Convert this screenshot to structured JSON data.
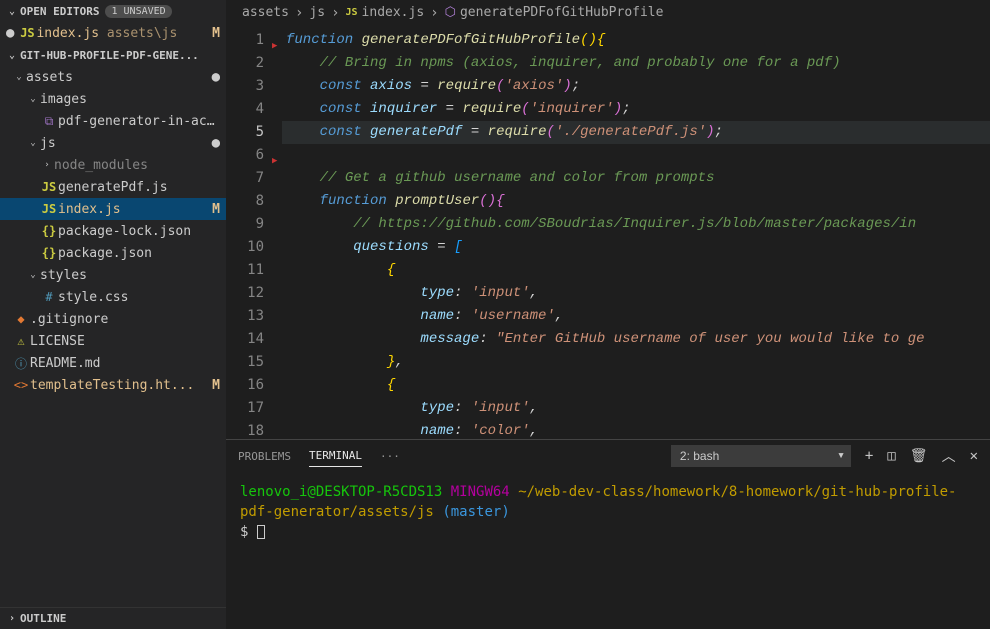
{
  "sidebar": {
    "openEditors": {
      "title": "OPEN EDITORS",
      "badge": "1 UNSAVED",
      "items": [
        {
          "name": "index.js",
          "path": "assets\\js",
          "status": "M",
          "iconClass": "icon-js",
          "iconText": "JS",
          "modified": true
        }
      ]
    },
    "project": {
      "title": "GIT-HUB-PROFILE-PDF-GENE...",
      "tree": [
        {
          "type": "folder",
          "name": "assets",
          "depth": 0,
          "open": true,
          "dot": true
        },
        {
          "type": "folder",
          "name": "images",
          "depth": 1,
          "open": true
        },
        {
          "type": "file",
          "name": "pdf-generator-in-acti...",
          "depth": 2,
          "iconClass": "icon-img",
          "iconText": "⧉"
        },
        {
          "type": "folder",
          "name": "js",
          "depth": 1,
          "open": true,
          "dot": true
        },
        {
          "type": "folder",
          "name": "node_modules",
          "depth": 2,
          "open": false,
          "dim": true
        },
        {
          "type": "file",
          "name": "generatePdf.js",
          "depth": 2,
          "iconClass": "icon-js",
          "iconText": "JS"
        },
        {
          "type": "file",
          "name": "index.js",
          "depth": 2,
          "iconClass": "icon-js",
          "iconText": "JS",
          "status": "M",
          "active": true,
          "modified": true
        },
        {
          "type": "file",
          "name": "package-lock.json",
          "depth": 2,
          "iconClass": "icon-json",
          "iconText": "{}"
        },
        {
          "type": "file",
          "name": "package.json",
          "depth": 2,
          "iconClass": "icon-json",
          "iconText": "{}"
        },
        {
          "type": "folder",
          "name": "styles",
          "depth": 1,
          "open": true
        },
        {
          "type": "file",
          "name": "style.css",
          "depth": 2,
          "iconClass": "icon-css",
          "iconText": "#"
        },
        {
          "type": "file",
          "name": ".gitignore",
          "depth": 0,
          "iconClass": "icon-git",
          "iconText": "◆"
        },
        {
          "type": "file",
          "name": "LICENSE",
          "depth": 0,
          "iconClass": "icon-lic",
          "iconText": "⚠"
        },
        {
          "type": "file",
          "name": "README.md",
          "depth": 0,
          "iconClass": "icon-md",
          "iconText": "ⓘ"
        },
        {
          "type": "file",
          "name": "templateTesting.ht...",
          "depth": 0,
          "iconClass": "icon-html",
          "iconText": "<>",
          "status": "M",
          "modified": true
        }
      ]
    },
    "outline": {
      "title": "OUTLINE"
    }
  },
  "breadcrumb": {
    "parts": [
      "assets",
      "js",
      "index.js",
      "generatePDFofGitHubProfile"
    ]
  },
  "editor": {
    "currentLine": 5,
    "lines": [
      {
        "n": 1,
        "html": "<span class='kw'>function</span> <span class='fn'>generatePDFofGitHubProfile</span><span class='br'>(</span><span class='br'>)</span><span class='br'>{</span>"
      },
      {
        "n": 2,
        "html": "    <span class='cm'>// Bring in npms (axios, inquirer, and probably one for a pdf)</span>"
      },
      {
        "n": 3,
        "html": "    <span class='kw'>const</span> <span class='vr'>axios</span> <span class='pn'>=</span> <span class='fn'>require</span><span class='br2'>(</span><span class='st'>'axios'</span><span class='br2'>)</span><span class='pn'>;</span>"
      },
      {
        "n": 4,
        "html": "    <span class='kw'>const</span> <span class='vr'>inquirer</span> <span class='pn'>=</span> <span class='fn'>require</span><span class='br2'>(</span><span class='st'>'inquirer'</span><span class='br2'>)</span><span class='pn'>;</span>"
      },
      {
        "n": 5,
        "html": "    <span class='kw'>const</span> <span class='vr'>generatePdf</span> <span class='pn'>=</span> <span class='fn'>require</span><span class='br2'>(</span><span class='st'>'./generatePdf.js'</span><span class='br2'>)</span><span class='pn'>;</span>",
        "hl": true
      },
      {
        "n": 6,
        "html": ""
      },
      {
        "n": 7,
        "html": "    <span class='cm'>// Get a github username and color from prompts</span>"
      },
      {
        "n": 8,
        "html": "    <span class='kw'>function</span> <span class='fn'>promptUser</span><span class='br2'>(</span><span class='br2'>)</span><span class='br2'>{</span>"
      },
      {
        "n": 9,
        "html": "        <span class='cm'>// https://github.com/SBoudrias/Inquirer.js/blob/master/packages/in</span>"
      },
      {
        "n": 10,
        "html": "        <span class='vr'>questions</span> <span class='pn'>=</span> <span class='br3'>[</span>"
      },
      {
        "n": 11,
        "html": "            <span class='br'>{</span>"
      },
      {
        "n": 12,
        "html": "                <span class='vr'>type</span><span class='pn'>:</span> <span class='st'>'input'</span><span class='pn'>,</span>"
      },
      {
        "n": 13,
        "html": "                <span class='vr'>name</span><span class='pn'>:</span> <span class='st'>'username'</span><span class='pn'>,</span>"
      },
      {
        "n": 14,
        "html": "                <span class='vr'>message</span><span class='pn'>:</span> <span class='st'>\"Enter GitHub username of user you would like to ge</span>"
      },
      {
        "n": 15,
        "html": "            <span class='br'>}</span><span class='pn'>,</span>"
      },
      {
        "n": 16,
        "html": "            <span class='br'>{</span>"
      },
      {
        "n": 17,
        "html": "                <span class='vr'>type</span><span class='pn'>:</span> <span class='st'>'input'</span><span class='pn'>,</span>"
      },
      {
        "n": 18,
        "html": "                <span class='vr'>name</span><span class='pn'>:</span> <span class='st'>'color'</span><span class='pn'>,</span>"
      }
    ]
  },
  "panel": {
    "tabs": {
      "problems": "PROBLEMS",
      "terminal": "TERMINAL",
      "more": "···"
    },
    "select": "2: bash",
    "terminal": {
      "user": "lenovo_i@DESKTOP-R5CDS13",
      "host": "MINGW64",
      "path": "~/web-dev-class/homework/8-homework/git-hub-profile-pdf-generator/assets/js",
      "branch": "(master)",
      "prompt": "$"
    }
  }
}
